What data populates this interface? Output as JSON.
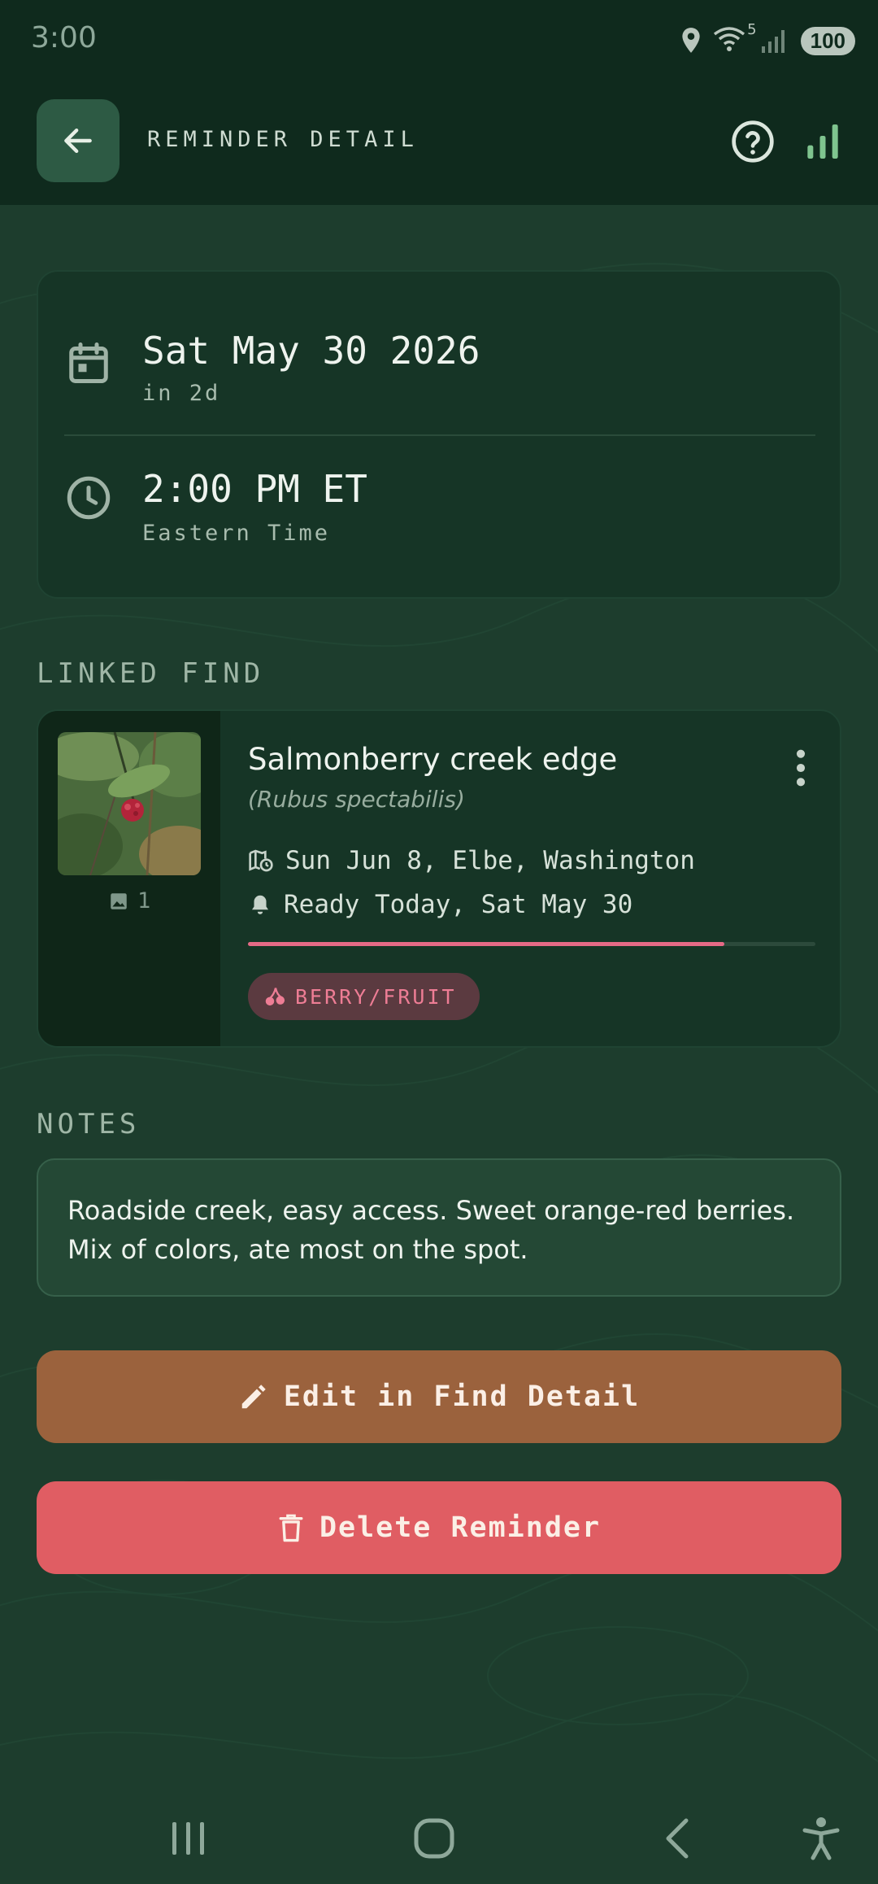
{
  "status_bar": {
    "time": "3:00",
    "wifi_badge": "5",
    "battery": "100"
  },
  "header": {
    "title": "REMINDER DETAIL",
    "back_icon": "arrow-left-icon",
    "help_icon": "help-circle-icon",
    "stats_icon": "bar-chart-icon"
  },
  "schedule": {
    "date": "Sat May 30 2026",
    "date_relative": "in 2d",
    "time": "2:00 PM ET",
    "timezone": "Eastern Time",
    "date_icon": "calendar-icon",
    "time_icon": "clock-icon"
  },
  "linked_find": {
    "section_label": "LINKED FIND",
    "title": "Salmonberry creek edge",
    "latin_name": "(Rubus spectabilis)",
    "photo_count": "1",
    "found_line": "Sun Jun 8, Elbe, Washington",
    "ready_line": "Ready Today, Sat May 30",
    "progress": 0.84,
    "tag": "BERRY/FRUIT",
    "accent_color": "#e56a86"
  },
  "notes": {
    "section_label": "NOTES",
    "text": "Roadside creek, easy access. Sweet orange-red berries. Mix of colors, ate most on the spot."
  },
  "actions": {
    "edit_label": "Edit in Find Detail",
    "delete_label": "Delete Reminder",
    "edit_color": "#9b623d",
    "delete_color": "#e05d63"
  }
}
